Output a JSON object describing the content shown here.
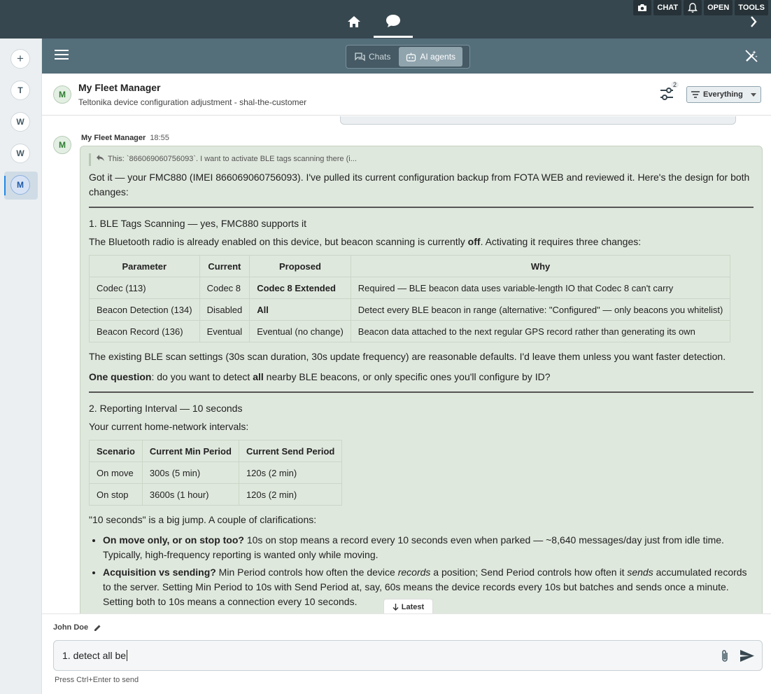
{
  "topbar": {
    "nav": [
      {
        "icon": "home-icon"
      },
      {
        "icon": "chat-icon",
        "active": true
      }
    ],
    "buttons": {
      "chat": "CHAT",
      "open": "OPEN",
      "tools": "TOOLS"
    }
  },
  "rail": {
    "items": [
      "+",
      "T",
      "W",
      "W",
      "M"
    ],
    "selected": "M"
  },
  "toolbar": {
    "tabs": [
      {
        "label": "Chats"
      },
      {
        "label": "AI agents",
        "active": true
      }
    ]
  },
  "header": {
    "avatar": "M",
    "title": "My Fleet Manager",
    "subtitle": "Teltonika device configuration adjustment - shal-the-customer",
    "filter_count": "2",
    "filter_select": "Everything"
  },
  "message": {
    "avatar": "M",
    "author": "My Fleet Manager",
    "time": "18:55",
    "quote": "This: `866069060756093`. I want to activate BLE tags scanning there (i...",
    "intro": "Got it — your FMC880 (IMEI 866069060756093). I've pulled its current configuration backup from FOTA WEB and reviewed it. Here's the design for both changes:",
    "s1_title": "1. BLE Tags Scanning — yes, FMC880 supports it",
    "s1_p1_a": "The Bluetooth radio is already enabled on this device, but beacon scanning is currently ",
    "s1_p1_b": "off",
    "s1_p1_c": ". Activating it requires three changes:",
    "table1": {
      "headers": [
        "Parameter",
        "Current",
        "Proposed",
        "Why"
      ],
      "rows": [
        [
          "Codec (113)",
          "Codec 8",
          "Codec 8 Extended",
          "Required — BLE beacon data uses variable-length IO that Codec 8 can't carry"
        ],
        [
          "Beacon Detection (134)",
          "Disabled",
          "All",
          "Detect every BLE beacon in range (alternative: \"Configured\" — only beacons you whitelist)"
        ],
        [
          "Beacon Record (136)",
          "Eventual",
          "Eventual (no change)",
          "Beacon data attached to the next regular GPS record rather than generating its own"
        ]
      ]
    },
    "s1_p2": "The existing BLE scan settings (30s scan duration, 30s update frequency) are reasonable defaults. I'd leave them unless you want faster detection.",
    "s1_q_a": "One question",
    "s1_q_b": ": do you want to detect ",
    "s1_q_c": "all",
    "s1_q_d": " nearby BLE beacons, or only specific ones you'll configure by ID?",
    "s2_title": "2. Reporting Interval — 10 seconds",
    "s2_p1": "Your current home-network intervals:",
    "table2": {
      "headers": [
        "Scenario",
        "Current Min Period",
        "Current Send Period"
      ],
      "rows": [
        [
          "On move",
          "300s (5 min)",
          "120s (2 min)"
        ],
        [
          "On stop",
          "3600s (1 hour)",
          "120s (2 min)"
        ]
      ]
    },
    "s2_p2": "\"10 seconds\" is a big jump. A couple of clarifications:",
    "b1_title": "On move only, or on stop too?",
    "b1_text": " 10s on stop means a record every 10 seconds even when parked — ~8,640 messages/day just from idle time. Typically, high-frequency reporting is wanted only while moving.",
    "b2_title": "Acquisition vs sending?",
    "b2_a": " Min Period controls how often the device ",
    "b2_b": "records",
    "b2_c": " a position; Send Period controls how often it ",
    "b2_d": "sends",
    "b2_e": " accumulated records to the server. Setting Min Period to 10s with Send Period at, say, 60s means the device records every 10s but batches and sends once a minute. Setting both to 10s means a connection every 10 seconds."
  },
  "latest_label": "Latest",
  "composer": {
    "user": "John Doe",
    "value": "1. detect all be",
    "hint": "Press Ctrl+Enter to send"
  }
}
